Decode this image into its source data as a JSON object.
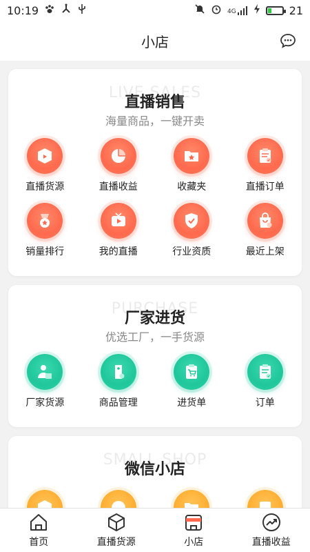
{
  "status_bar": {
    "time": "10:19",
    "battery_level": "21",
    "network": "4G"
  },
  "header": {
    "title": "小店",
    "message_icon": "chat-bubble-icon"
  },
  "sections": [
    {
      "bg_text": "LIVE SALES",
      "title": "直播销售",
      "subtitle": "海量商品，一键开卖",
      "items": [
        {
          "label": "直播货源",
          "icon": "box-play-icon"
        },
        {
          "label": "直播收益",
          "icon": "pie-chart-icon"
        },
        {
          "label": "收藏夹",
          "icon": "star-folder-icon"
        },
        {
          "label": "直播订单",
          "icon": "clipboard-check-icon"
        },
        {
          "label": "销量排行",
          "icon": "medal-icon"
        },
        {
          "label": "我的直播",
          "icon": "tv-play-icon"
        },
        {
          "label": "行业资质",
          "icon": "shield-check-icon"
        },
        {
          "label": "最近上架",
          "icon": "bag-clock-icon"
        }
      ]
    },
    {
      "bg_text": "PURCHASE",
      "title": "厂家进货",
      "subtitle": "优选工厂，一手货源",
      "items": [
        {
          "label": "厂家货源",
          "icon": "person-box-icon"
        },
        {
          "label": "商品管理",
          "icon": "tag-icon"
        },
        {
          "label": "进货单",
          "icon": "cart-clipboard-icon"
        },
        {
          "label": "订单",
          "icon": "clipboard-check-icon"
        }
      ]
    },
    {
      "bg_text": "SMALL SHOP",
      "title": "微信小店",
      "subtitle": "",
      "items": [
        {
          "label": "",
          "icon": "box-icon"
        },
        {
          "label": "",
          "icon": "pie-chart-icon"
        },
        {
          "label": "",
          "icon": "folder-icon"
        },
        {
          "label": "",
          "icon": "clipboard-icon"
        }
      ]
    }
  ],
  "tabbar": [
    {
      "label": "首页",
      "icon": "home-icon"
    },
    {
      "label": "直播货源",
      "icon": "cube-icon"
    },
    {
      "label": "小店",
      "icon": "shop-icon",
      "active": true
    },
    {
      "label": "直播收益",
      "icon": "trend-up-icon"
    }
  ],
  "colors": {
    "orange": "#ff6a4e",
    "green": "#20c79b",
    "yellow": "#ffaa2c"
  }
}
